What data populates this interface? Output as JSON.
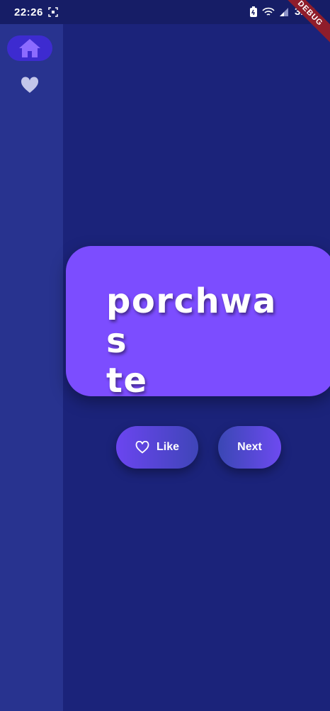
{
  "status_bar": {
    "time": "22:26",
    "battery": "31%"
  },
  "debug_banner": "DEBUG",
  "navigation_rail": {
    "items": [
      {
        "icon": "home-icon",
        "selected": true
      },
      {
        "icon": "heart-filled-icon",
        "selected": false
      }
    ],
    "selected_color": "#3d2bd0"
  },
  "main": {
    "word_line1": "porchwas",
    "word_line2": "te",
    "card_color": "#7c4dff"
  },
  "actions": {
    "like_label": "Like",
    "next_label": "Next"
  }
}
